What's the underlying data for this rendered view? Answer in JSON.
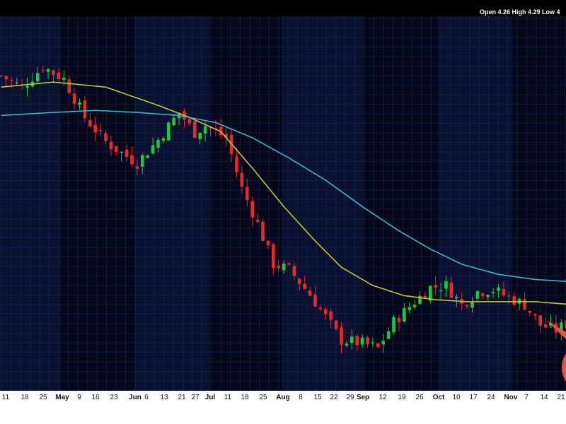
{
  "header": {
    "ohlc_text": "Open 4.26  High 4.29  Low 4"
  },
  "chart_data": {
    "type": "candlestick",
    "title": "",
    "xlabel": "",
    "ylabel": "",
    "ylim": [
      2.3,
      6.0
    ],
    "grid": true,
    "x_tick_labels": [
      {
        "label": "11",
        "month": false
      },
      {
        "label": "18",
        "month": false
      },
      {
        "label": "25",
        "month": false
      },
      {
        "label": "May",
        "month": true
      },
      {
        "label": "9",
        "month": false
      },
      {
        "label": "16",
        "month": false
      },
      {
        "label": "23",
        "month": false
      },
      {
        "label": "Jun",
        "month": true
      },
      {
        "label": "6",
        "month": false
      },
      {
        "label": "13",
        "month": false
      },
      {
        "label": "21",
        "month": false
      },
      {
        "label": "27",
        "month": false
      },
      {
        "label": "Jul",
        "month": true
      },
      {
        "label": "11",
        "month": false
      },
      {
        "label": "18",
        "month": false
      },
      {
        "label": "25",
        "month": false
      },
      {
        "label": "Aug",
        "month": true
      },
      {
        "label": "8",
        "month": false
      },
      {
        "label": "15",
        "month": false
      },
      {
        "label": "22",
        "month": false
      },
      {
        "label": "29",
        "month": false
      },
      {
        "label": "Sep",
        "month": true
      },
      {
        "label": "12",
        "month": false
      },
      {
        "label": "19",
        "month": false
      },
      {
        "label": "26",
        "month": false
      },
      {
        "label": "Oct",
        "month": true
      },
      {
        "label": "10",
        "month": false
      },
      {
        "label": "17",
        "month": false
      },
      {
        "label": "24",
        "month": false
      },
      {
        "label": "Nov",
        "month": true
      },
      {
        "label": "7",
        "month": false
      },
      {
        "label": "14",
        "month": false
      },
      {
        "label": "21",
        "month": false
      }
    ],
    "close_path": [
      [
        0,
        5.41
      ],
      [
        8,
        5.3
      ],
      [
        16,
        5.5
      ],
      [
        24,
        5.38
      ],
      [
        32,
        5.0
      ],
      [
        40,
        4.76
      ],
      [
        46,
        4.65
      ],
      [
        52,
        4.55
      ],
      [
        60,
        4.78
      ],
      [
        68,
        5.05
      ],
      [
        74,
        4.85
      ],
      [
        78,
        4.92
      ],
      [
        86,
        4.8
      ],
      [
        92,
        4.3
      ],
      [
        98,
        3.95
      ],
      [
        104,
        3.55
      ],
      [
        110,
        3.5
      ],
      [
        118,
        3.25
      ],
      [
        124,
        3.03
      ],
      [
        130,
        2.8
      ],
      [
        138,
        2.77
      ],
      [
        144,
        2.72
      ],
      [
        150,
        2.98
      ],
      [
        158,
        3.18
      ],
      [
        164,
        3.32
      ],
      [
        170,
        3.34
      ],
      [
        176,
        3.15
      ],
      [
        182,
        3.28
      ],
      [
        188,
        3.3
      ],
      [
        194,
        3.22
      ],
      [
        200,
        3.15
      ],
      [
        206,
        2.95
      ],
      [
        212,
        2.9
      ],
      [
        220,
        3.02
      ],
      [
        228,
        3.2
      ],
      [
        234,
        3.18
      ],
      [
        240,
        2.95
      ],
      [
        246,
        2.85
      ],
      [
        252,
        3.1
      ],
      [
        258,
        3.35
      ],
      [
        264,
        3.52
      ],
      [
        270,
        3.68
      ],
      [
        276,
        3.32
      ],
      [
        280,
        3.1
      ]
    ],
    "sma_short": [
      [
        0,
        5.3
      ],
      [
        20,
        5.35
      ],
      [
        40,
        5.3
      ],
      [
        60,
        5.12
      ],
      [
        72,
        5.0
      ],
      [
        84,
        4.86
      ],
      [
        96,
        4.5
      ],
      [
        108,
        4.12
      ],
      [
        120,
        3.78
      ],
      [
        130,
        3.52
      ],
      [
        142,
        3.34
      ],
      [
        154,
        3.24
      ],
      [
        166,
        3.2
      ],
      [
        178,
        3.18
      ],
      [
        190,
        3.18
      ],
      [
        204,
        3.18
      ],
      [
        214,
        3.16
      ],
      [
        224,
        3.14
      ],
      [
        236,
        3.12
      ],
      [
        248,
        3.1
      ],
      [
        258,
        3.13
      ],
      [
        266,
        3.2
      ],
      [
        274,
        3.22
      ],
      [
        280,
        3.22
      ]
    ],
    "sma_long": [
      [
        0,
        5.02
      ],
      [
        20,
        5.05
      ],
      [
        36,
        5.07
      ],
      [
        52,
        5.05
      ],
      [
        68,
        5.02
      ],
      [
        82,
        4.95
      ],
      [
        96,
        4.8
      ],
      [
        110,
        4.6
      ],
      [
        124,
        4.38
      ],
      [
        138,
        4.12
      ],
      [
        152,
        3.88
      ],
      [
        164,
        3.7
      ],
      [
        176,
        3.55
      ],
      [
        190,
        3.45
      ],
      [
        204,
        3.4
      ],
      [
        216,
        3.38
      ],
      [
        228,
        3.35
      ],
      [
        240,
        3.32
      ],
      [
        252,
        3.26
      ],
      [
        262,
        3.2
      ],
      [
        270,
        3.21
      ],
      [
        280,
        3.22
      ]
    ],
    "colors": {
      "background": "#000000",
      "band": "#0a1030",
      "band_alt": "#05081a",
      "grid": "#2a3a78",
      "up": "#22c83a",
      "down": "#e62a2a",
      "sma_short": "#c9c330",
      "sma_long": "#3ab6c4",
      "annotation": "#e5523d",
      "axis_bg": "#ffffff",
      "header_text": "#ffffff"
    }
  }
}
